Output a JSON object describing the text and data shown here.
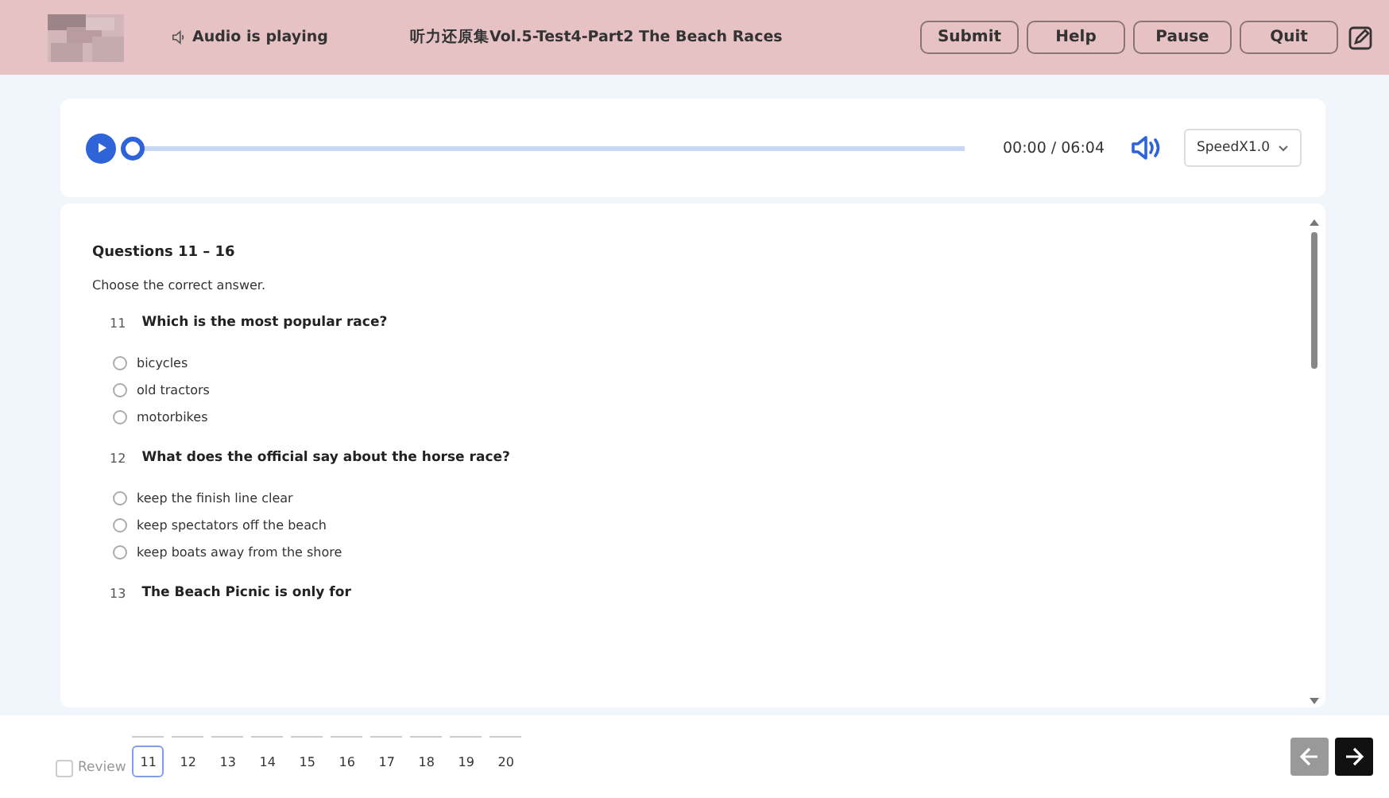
{
  "header": {
    "status": "Audio is playing",
    "title": "听力还原集Vol.5-Test4-Part2 The Beach Races",
    "buttons": [
      "Submit",
      "Help",
      "Pause",
      "Quit"
    ]
  },
  "player": {
    "level": 0,
    "time": "00:00 / 06:04",
    "speed": "SpeedX1.0"
  },
  "section": {
    "heading": "Questions 11 – 16",
    "instruction": "Choose the correct answer.",
    "questions": [
      {
        "number": "11",
        "text": "Which is the most popular race?",
        "options": [
          {
            "label": "bicycles",
            "selected": false
          },
          {
            "label": "old tractors",
            "selected": false
          },
          {
            "label": "motorbikes",
            "selected": false
          }
        ]
      },
      {
        "number": "12",
        "text": "What does the official say about the horse race?",
        "options": [
          {
            "label": "keep the finish line clear",
            "selected": false
          },
          {
            "label": "keep spectators off the beach",
            "selected": false
          },
          {
            "label": "keep boats away from the shore",
            "selected": false
          }
        ]
      },
      {
        "number": "13",
        "text": "The Beach Picnic is only for"
      }
    ]
  },
  "footer": {
    "review": {
      "label": "Review",
      "checked": false
    },
    "pages": [
      {
        "label": "11",
        "selected": true
      },
      {
        "label": "12",
        "selected": false
      },
      {
        "label": "13",
        "selected": false
      },
      {
        "label": "14",
        "selected": false
      },
      {
        "label": "15",
        "selected": false
      },
      {
        "label": "16",
        "selected": false
      },
      {
        "label": "17",
        "selected": false
      },
      {
        "label": "18",
        "selected": false
      },
      {
        "label": "19",
        "selected": false
      },
      {
        "label": "20",
        "selected": false
      }
    ],
    "prev": {
      "disabled": true
    },
    "next": {
      "disabled": false
    }
  }
}
